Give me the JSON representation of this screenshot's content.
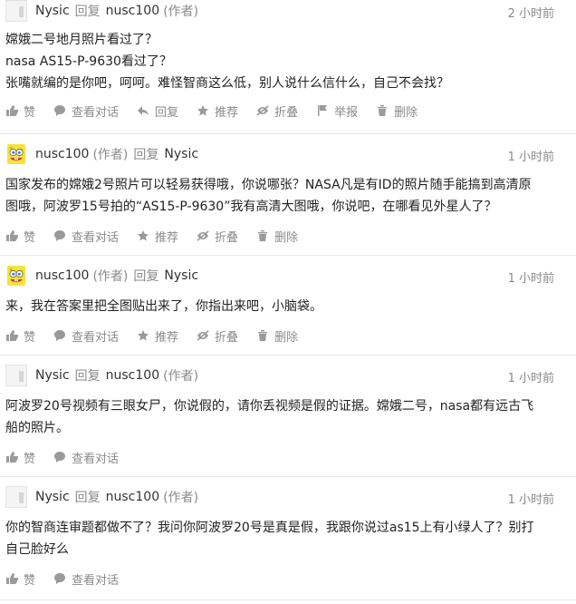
{
  "comments": [
    {
      "author": "Nysic",
      "reply_word": "回复",
      "reply_to": "nusc100",
      "reply_tag": "(作者)",
      "time": "2 小时前",
      "lines": [
        "嫦娥二号地月照片看过了？",
        "nasa AS15-P-9630看过了？",
        "张嘴就编的是你吧，呵呵。难怪智商这么低，别人说什么信什么，自己不会找？"
      ],
      "actions": [
        "赞",
        "查看对话",
        "回复",
        "推荐",
        "折叠",
        "举报",
        "删除"
      ]
    },
    {
      "author": "nusc100",
      "author_tag": "(作者)",
      "reply_word": "回复",
      "reply_to": "Nysic",
      "time": "1 小时前",
      "lines": [
        "国家发布的嫦娥2号照片可以轻易获得哦，你说哪张？NASA凡是有ID的照片随手能搞到高清原",
        "图哦，阿波罗15号拍的“AS15-P-9630”我有高清大图哦，你说吧，在哪看见外星人了？"
      ],
      "actions": [
        "赞",
        "查看对话",
        "推荐",
        "折叠",
        "删除"
      ]
    },
    {
      "author": "nusc100",
      "author_tag": "(作者)",
      "reply_word": "回复",
      "reply_to": "Nysic",
      "time": "1 小时前",
      "lines": [
        "来，我在答案里把全图贴出来了，你指出来吧，小脑袋。"
      ],
      "actions": [
        "赞",
        "查看对话",
        "推荐",
        "折叠",
        "删除"
      ]
    },
    {
      "author": "Nysic",
      "reply_word": "回复",
      "reply_to": "nusc100",
      "reply_tag": "(作者)",
      "time": "1 小时前",
      "lines": [
        "阿波罗20号视频有三眼女尸，你说假的，请你丢视频是假的证据。嫦娥二号，nasa都有远古飞",
        "船的照片。"
      ],
      "actions": [
        "赞",
        "查看对话"
      ]
    },
    {
      "author": "Nysic",
      "reply_word": "回复",
      "reply_to": "nusc100",
      "reply_tag": "(作者)",
      "time": "1 小时前",
      "lines": [
        "你的智商连审题都做不了？我问你阿波罗20号是真是假，我跟你说过as15上有小绿人了？别打",
        "自己脸好么"
      ],
      "actions": [
        "赞",
        "查看对话"
      ]
    }
  ],
  "action_icons": {
    "赞": "thumbs-up-icon",
    "查看对话": "chat-bubble-icon",
    "回复": "reply-arrow-icon",
    "推荐": "star-icon",
    "折叠": "eye-off-icon",
    "举报": "flag-icon",
    "删除": "trash-icon"
  },
  "avatars": {
    "Nysic": "plain",
    "nusc100": "sponge"
  }
}
